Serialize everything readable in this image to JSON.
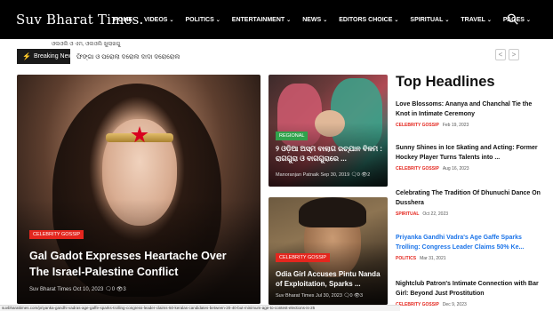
{
  "nav": {
    "logo": "Suv Bharat Times.",
    "items": [
      {
        "label": "HOME",
        "dropdown": false
      },
      {
        "label": "VIDEOS",
        "dropdown": true
      },
      {
        "label": "POLITICS",
        "dropdown": true
      },
      {
        "label": "ENTERTAINMENT",
        "dropdown": true
      },
      {
        "label": "NEWS",
        "dropdown": true
      },
      {
        "label": "EDITORS CHOICE",
        "dropdown": true
      },
      {
        "label": "SPIRITUAL",
        "dropdown": true
      },
      {
        "label": "TRAVEL",
        "dropdown": true
      },
      {
        "label": "PAGES",
        "dropdown": true
      }
    ],
    "search_icon": "search-icon"
  },
  "breaking": {
    "label": "Breaking News",
    "subline": "ଓଲଓଲି ଓ ଏମ, ଓଲଓଲି ଖୁଲାଖଗୁ",
    "ticker": "ଫିଙ୍ଗା ଓ ପରୋଲା ଦରୋଲ ଦାଦା ଦରୋରୋଲ",
    "prev": "<",
    "next": ">"
  },
  "hero": {
    "category": "CELEBRITY GOSSIP",
    "title": "Gal Gadot Expresses Heartache Over The Israel-Palestine Conflict",
    "author": "Suv Bharat Times",
    "date": "Oct 10, 2023",
    "comments": "0",
    "views": "3"
  },
  "card1": {
    "category": "REGIONAL",
    "title": "୨ ଓଡ଼ିଆ ଅସ୍ମ ବାଲାଗ ରଚ୍ଯାନ ବିଳମ : ରାଗଗୁରା ଓ ବାଗଗୁରାରେ ...",
    "author": "Manoranjan Patnaik",
    "date": "Sep 30, 2019",
    "comments": "0",
    "views": "2"
  },
  "card2": {
    "category": "CELEBRITY GOSSIP",
    "title": "Odia Girl Accuses Pintu Nanda of Exploitation, Sparks ...",
    "author": "Suv Bharat Times",
    "date": "Jul 30, 2023",
    "comments": "0",
    "views": "3"
  },
  "top_headlines": {
    "title": "Top Headlines",
    "items": [
      {
        "title": "Love Blossoms: Ananya and Chanchal Tie the Knot in Intimate Ceremony",
        "category": "CELEBRITY GOSSIP",
        "date": "Feb 19, 2023",
        "link_style": false
      },
      {
        "title": "Sunny Shines in Ice Skating and Acting: Former Hockey Player Turns Talents into ...",
        "category": "CELEBRITY GOSSIP",
        "date": "Aug 16, 2023",
        "link_style": false
      },
      {
        "title": "Celebrating The Tradition Of Dhunuchi Dance On Dusshera",
        "category": "SPIRITUAL",
        "date": "Oct 22, 2023",
        "link_style": false
      },
      {
        "title": "Priyanka Gandhi Vadra's Age Gaffe Sparks Trolling: Congress Leader Claims 50% Ke...",
        "category": "POLITICS",
        "date": "Mar 31, 2021",
        "link_style": true
      },
      {
        "title": "Nightclub Patron's Intimate Connection with Bar Girl: Beyond Just Prostitution",
        "category": "CELEBRITY GOSSIP",
        "date": "Dec 9, 2023",
        "link_style": false
      }
    ]
  },
  "status_url": "suvbharattimes.com/priyanka-gandhi-vadras-age-gaffe-sparks-trolling-congress-leader-claims-50-keralas-candidates-between-20-40-but-minimum-age-to-contest-elections-is-25",
  "colors": {
    "nav_bg": "#000000",
    "accent_red": "#e4261e",
    "accent_green": "#31a24c",
    "link_blue": "#1a73e8"
  }
}
